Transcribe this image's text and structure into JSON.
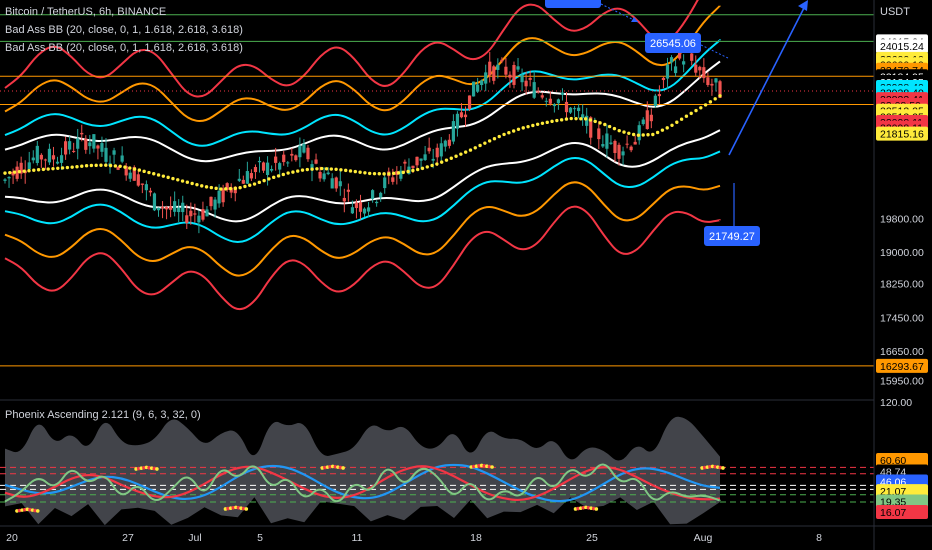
{
  "header": {
    "symbol_line": "Bitcoin / TetherUS, 6h, BINANCE",
    "indicator_1": "Bad Ass BB (20, close, 0, 1, 1.618, 2.618, 3.618)",
    "indicator_2": "Bad Ass BB (20, close, 0, 1, 1.618, 2.618, 3.618)",
    "oscillator": "Phoenix Ascending 2.121 (9, 6, 3, 32, 0)",
    "currency": "USDT"
  },
  "colors": {
    "background": "#000000",
    "up_candle": "#26a69a",
    "down_candle": "#ef5350",
    "band_outer": "#f23645",
    "band_mid": "#ff9800",
    "band_inner": "#00e5ff",
    "band_core": "#ffffff",
    "basis": "#ffeb3b",
    "hline_green": "#4caf50",
    "hline_orange": "#ff9800",
    "arrow": "#2962ff"
  },
  "chart_data": [
    {
      "type": "candlestick",
      "title": "Bitcoin / TetherUS, 6h, BINANCE",
      "ylim": [
        15600,
        25000
      ],
      "x_ticks": [
        "20",
        "27",
        "Jul",
        "5",
        "11",
        "18",
        "25",
        "Aug",
        "8"
      ],
      "axis_price_ticks": [
        19800.0,
        19000.0,
        18250.0,
        17450.0,
        16650.0,
        15950.0
      ],
      "axis_labels": [
        {
          "value": "24015.24",
          "price": 24015.24,
          "color": "#ffffff",
          "text_color": "#000000"
        },
        {
          "value": "24015.24",
          "price": 23900,
          "color": "#ffffff",
          "text_color": "#000000"
        },
        {
          "value": "23600.10",
          "price": 23600.1,
          "color": "#ffeb3b",
          "text_color": "#000000"
        },
        {
          "value": "23600.10",
          "price": 23470,
          "color": "#ffeb3b",
          "text_color": "#000000"
        },
        {
          "value": "23473.74",
          "price": 23340,
          "color": "#ff9800",
          "text_color": "#000000"
        },
        {
          "value": "23184.95",
          "price": 23184.95,
          "color": "#000000",
          "text_color": "#ffffff"
        },
        {
          "value": "23184.95",
          "price": 23050,
          "color": "#000000",
          "text_color": "#ffffff"
        },
        {
          "value": "22928.40",
          "price": 22928.4,
          "color": "#00e5ff",
          "text_color": "#000000"
        },
        {
          "value": "22928.40",
          "price": 22795,
          "color": "#00e5ff",
          "text_color": "#000000"
        },
        {
          "value": "22833.41",
          "price": 22640,
          "color": "#f23645",
          "text_color": "#000000"
        },
        {
          "value": "03:08:50",
          "price": 22500,
          "color": "#f23645",
          "text_color": "#000000"
        },
        {
          "value": "22513.25",
          "price": 22365,
          "color": "#ffeb3b",
          "text_color": "#000000"
        },
        {
          "value": "22513.25",
          "price": 22230,
          "color": "#ffeb3b",
          "text_color": "#000000"
        },
        {
          "value": "22098.11",
          "price": 22098.11,
          "color": "#f23645",
          "text_color": "#000000"
        },
        {
          "value": "22098.11",
          "price": 21960,
          "color": "#f23645",
          "text_color": "#000000"
        },
        {
          "value": "21815.16",
          "price": 21820,
          "color": "#ffeb3b",
          "text_color": "#000000"
        },
        {
          "value": "16293.67",
          "price": 16293.67,
          "color": "#ff9800",
          "text_color": "#000000"
        }
      ],
      "horizontal_levels": [
        {
          "price": 24650,
          "color": "#4caf50"
        },
        {
          "price": 24015.24,
          "color": "#4caf50"
        },
        {
          "price": 23184.95,
          "color": "#ff9800"
        },
        {
          "price": 22833.41,
          "color": "#f23645",
          "dotted": true
        },
        {
          "price": 22513.25,
          "color": "#ff9800"
        },
        {
          "price": 16293.67,
          "color": "#ff9800"
        }
      ],
      "annotations": [
        {
          "text": "26545.06",
          "kind": "callout"
        },
        {
          "text": "21749.27",
          "kind": "callout"
        }
      ],
      "series": [
        {
          "name": "basis",
          "values": [
            20880,
            20920,
            20960,
            20990,
            21020,
            21060,
            21070,
            21040,
            20960,
            20860,
            20760,
            20660,
            20560,
            20500,
            20520,
            20620,
            20760,
            20880,
            20960,
            20990,
            20970,
            20920,
            20870,
            20860,
            20900,
            20980,
            21100,
            21260,
            21430,
            21620,
            21800,
            21940,
            22040,
            22120,
            22180,
            22170,
            22050,
            21880,
            21780,
            21800,
            21990,
            22240,
            22470,
            22720
          ]
        },
        {
          "name": "price",
          "values": [
            20700,
            21050,
            21300,
            21250,
            21500,
            21700,
            21350,
            21150,
            20800,
            20200,
            20000,
            19900,
            19950,
            20300,
            20700,
            20900,
            21050,
            21100,
            21400,
            20900,
            20700,
            20100,
            20200,
            20700,
            21000,
            21200,
            21300,
            21900,
            22700,
            23300,
            23350,
            23150,
            22850,
            22700,
            22450,
            22050,
            21700,
            21450,
            21700,
            22400,
            23400,
            23700,
            23200,
            22830
          ]
        }
      ]
    },
    {
      "type": "line",
      "title": "Phoenix Ascending 2.121 (9, 6, 3, 32, 0)",
      "ylim": [
        -4,
        120
      ],
      "axis_labels": [
        {
          "value": "120.00",
          "price": 120,
          "color": "#000000",
          "text_color": "#d1d4dc"
        },
        {
          "value": "60.60",
          "price": 60.6,
          "color": "#ff9800",
          "text_color": "#000000"
        },
        {
          "value": "48.74",
          "price": 48.74,
          "color": "#000000",
          "text_color": "#d1d4dc"
        },
        {
          "value": "46.06",
          "price": 38.5,
          "color": "#2962ff",
          "text_color": "#ffffff"
        },
        {
          "value": "21.07",
          "price": 28.7,
          "color": "#ffeb3b",
          "text_color": "#000000"
        },
        {
          "value": "19.35",
          "price": 18,
          "color": "#81c784",
          "text_color": "#000000"
        },
        {
          "value": "16.07",
          "price": 7.3,
          "color": "#f23645",
          "text_color": "#000000"
        }
      ],
      "levels": [
        {
          "price": 53,
          "color": "#f23645"
        },
        {
          "price": 46.5,
          "color": "#f23645"
        },
        {
          "price": 34.5,
          "color": "#ffffff"
        },
        {
          "price": 30.5,
          "color": "#ffffff"
        },
        {
          "price": 25,
          "color": "#4caf50"
        },
        {
          "price": 17.5,
          "color": "#4caf50"
        }
      ],
      "series": [
        {
          "name": "blue",
          "color": "#2196f3",
          "values": [
            35,
            30,
            26,
            27,
            33,
            40,
            44,
            42,
            36,
            28,
            22,
            20,
            24,
            33,
            44,
            52,
            55,
            53,
            46,
            36,
            27,
            22,
            21,
            26,
            36,
            46,
            54,
            56,
            54,
            47,
            38,
            29,
            22,
            18,
            19,
            26,
            36,
            46,
            52,
            52,
            47,
            40,
            34,
            32
          ]
        },
        {
          "name": "red",
          "color": "#f23645",
          "values": [
            27,
            22,
            25,
            33,
            42,
            46,
            43,
            35,
            28,
            23,
            22,
            27,
            36,
            46,
            53,
            54,
            48,
            40,
            31,
            24,
            21,
            24,
            32,
            43,
            51,
            55,
            52,
            44,
            35,
            26,
            21,
            19,
            23,
            31,
            41,
            50,
            54,
            51,
            43,
            34,
            27,
            22,
            20,
            21
          ]
        },
        {
          "name": "green",
          "color": "#81c784",
          "values": [
            18,
            28,
            45,
            30,
            55,
            35,
            48,
            20,
            38,
            15,
            30,
            48,
            22,
            55,
            40,
            60,
            30,
            45,
            18,
            35,
            12,
            40,
            25,
            58,
            32,
            55,
            45,
            20,
            42,
            15,
            32,
            20,
            48,
            28,
            55,
            40,
            62,
            35,
            45,
            15,
            30,
            22,
            25,
            19
          ]
        }
      ],
      "x_ticks": [
        "20",
        "27",
        "Jul",
        "5",
        "11",
        "18",
        "25",
        "Aug",
        "8"
      ]
    }
  ]
}
